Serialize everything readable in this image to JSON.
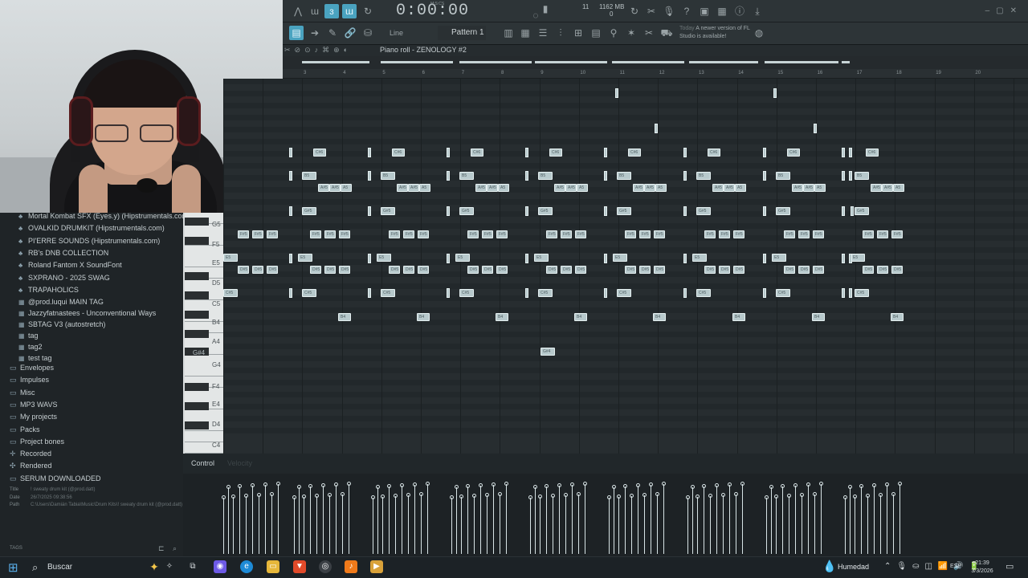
{
  "toolbar": {
    "time": "0:00:00",
    "time_label": "M:S:CS",
    "mem": "1162 MB",
    "cpu_top": "11",
    "cpu_bottom": "0"
  },
  "toolbar2": {
    "line_label": "Line",
    "pattern": "Pattern 1",
    "update_note_day": "Today",
    "update_note_text": "A newer version of FL Studio is available!"
  },
  "piano_roll": {
    "title": "Piano roll - ZENOLOGY #2"
  },
  "ruler": {
    "bars": [
      "3",
      "4",
      "5",
      "6",
      "7",
      "8",
      "9",
      "10",
      "11",
      "12",
      "13",
      "14",
      "15",
      "16",
      "17",
      "18",
      "19",
      "20"
    ]
  },
  "browser": {
    "items": [
      {
        "label": "Mortal Kombat SFX (Eyes.y) (Hipstrumentals.com)",
        "icon": "pack-icon"
      },
      {
        "label": "OVALKID DRUMKIT (Hipstrumentals.com)",
        "icon": "pack-icon"
      },
      {
        "label": "PI'ERRE SOUNDS (Hipstrumentals.com)",
        "icon": "pack-icon"
      },
      {
        "label": "RB's DNB COLLECTION",
        "icon": "pack-icon"
      },
      {
        "label": "Roland Fantom X SoundFont",
        "icon": "pack-icon"
      },
      {
        "label": "SXPRANO - 2025 SWAG",
        "icon": "pack-icon"
      },
      {
        "label": "TRAPAHOLICS",
        "icon": "pack-icon"
      },
      {
        "label": "@prod.luqui MAIN TAG",
        "icon": "audio-file-icon"
      },
      {
        "label": "Jazzyfatnastees - Unconventional Ways",
        "icon": "audio-file-icon"
      },
      {
        "label": "SBTAG V3 (autostretch)",
        "icon": "audio-file-icon"
      },
      {
        "label": "tag",
        "icon": "audio-file-icon"
      },
      {
        "label": "tag2",
        "icon": "audio-file-icon"
      },
      {
        "label": "test tag",
        "icon": "audio-file-icon"
      }
    ],
    "folders": [
      {
        "label": "Envelopes",
        "icon": "folder-icon"
      },
      {
        "label": "Impulses",
        "icon": "folder-icon"
      },
      {
        "label": "Misc",
        "icon": "folder-icon"
      },
      {
        "label": "MP3 WAVS",
        "icon": "folder-icon"
      },
      {
        "label": "My projects",
        "icon": "folder-icon"
      },
      {
        "label": "Packs",
        "icon": "folder-icon"
      },
      {
        "label": "Project bones",
        "icon": "folder-icon"
      },
      {
        "label": "Recorded",
        "icon": "plus-icon"
      },
      {
        "label": "Rendered",
        "icon": "rendered-icon"
      },
      {
        "label": "SERUM DOWNLOADED",
        "icon": "folder-icon"
      }
    ],
    "info": {
      "title_label": "Title",
      "title_value": "! sweaty drum kit (@prod.datt)",
      "date_label": "Date",
      "date_value": "26/7/2025 09:38:56",
      "path_label": "Path",
      "path_value": "C:\\Users\\Damián Tabia\\Music\\Drum Kits\\! sweaty drum kit (@prod.datt)"
    },
    "tags_label": "TAGS"
  },
  "keys": {
    "labels": [
      "G5",
      "F5",
      "E5",
      "D5",
      "C5",
      "B4",
      "A4",
      "G4",
      "F4",
      "E4",
      "D4",
      "C4"
    ],
    "hover_key": "G#4"
  },
  "notes": {
    "c6": "C#6",
    "b5": "B5",
    "as5": "A#5",
    "gs5": "G#5",
    "fs5": "F#5",
    "e5": "E5",
    "ds5": "D#5",
    "cs5": "C#5",
    "b4": "B4",
    "gs4": "G#4",
    "a5": "A5"
  },
  "control": {
    "label": "Control",
    "velocity_label": "Velocity"
  },
  "taskbar": {
    "search_placeholder": "Buscar",
    "weather": "Humedad",
    "lang": "ESP",
    "time": "21:39",
    "date": "3/3/2026"
  },
  "colors": {
    "accent": "#4aa3c0",
    "note_fill": "#b7c9cc",
    "grid_bg": "#272d30"
  }
}
